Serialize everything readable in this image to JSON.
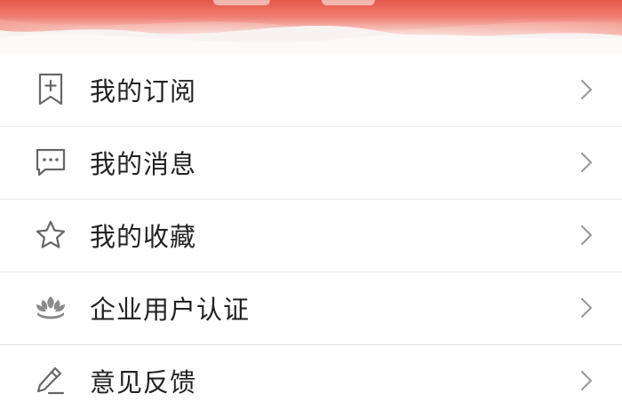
{
  "theme": {
    "header_top": "#e85a4a",
    "header_mid": "#f08478",
    "header_light": "#fbe3df",
    "icon_color": "#666666",
    "chevron_color": "#9a9a9a",
    "text_color": "#222222",
    "divider": "#e4e4e4"
  },
  "menu": {
    "items": [
      {
        "label": "我的订阅",
        "icon": "bookmark-plus-icon"
      },
      {
        "label": "我的消息",
        "icon": "message-bubble-icon"
      },
      {
        "label": "我的收藏",
        "icon": "star-icon"
      },
      {
        "label": "企业用户认证",
        "icon": "lotus-icon"
      },
      {
        "label": "意见反馈",
        "icon": "pencil-icon"
      }
    ]
  }
}
